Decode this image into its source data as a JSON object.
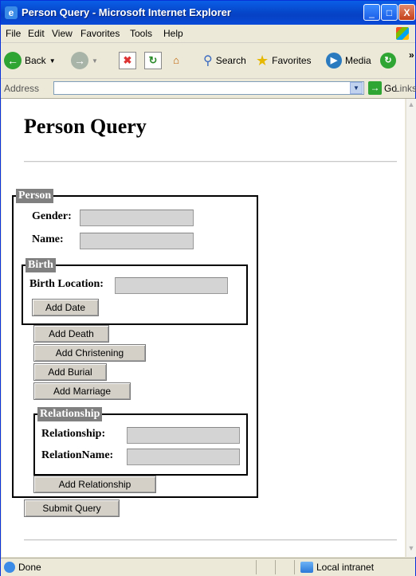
{
  "window": {
    "title": "Person Query - Microsoft Internet Explorer",
    "title_icon": "ie-icon",
    "controls": {
      "minimize": "_",
      "maximize": "□",
      "close": "X"
    }
  },
  "menu": [
    "File",
    "Edit",
    "View",
    "Favorites",
    "Tools",
    "Help"
  ],
  "toolbar": {
    "back": "Back",
    "search": "Search",
    "favorites": "Favorites",
    "media": "Media",
    "overflow": "»"
  },
  "address": {
    "label": "Address",
    "value": "",
    "go": "Go",
    "links": "Links"
  },
  "page": {
    "title": "Person Query",
    "person_legend": "Person",
    "gender_label": "Gender:",
    "gender_value": "",
    "name_label": "Name:",
    "name_value": "",
    "birth_legend": "Birth",
    "birth_location_label": "Birth Location:",
    "birth_location_value": "",
    "add_date": "Add Date",
    "add_death": "Add Death",
    "add_christening": "Add Christening",
    "add_burial": "Add Burial",
    "add_marriage": "Add Marriage",
    "relationship_legend": "Relationship",
    "relationship_label": "Relationship:",
    "relationship_value": "",
    "relation_name_label": "RelationName:",
    "relation_name_value": "",
    "add_relationship": "Add Relationship",
    "submit": "Submit Query"
  },
  "status": {
    "text": "Done",
    "zone": "Local intranet"
  },
  "colors": {
    "title_bar": "#0541c4",
    "legend_bg": "#808080",
    "input_bg": "#d4d4d4"
  }
}
